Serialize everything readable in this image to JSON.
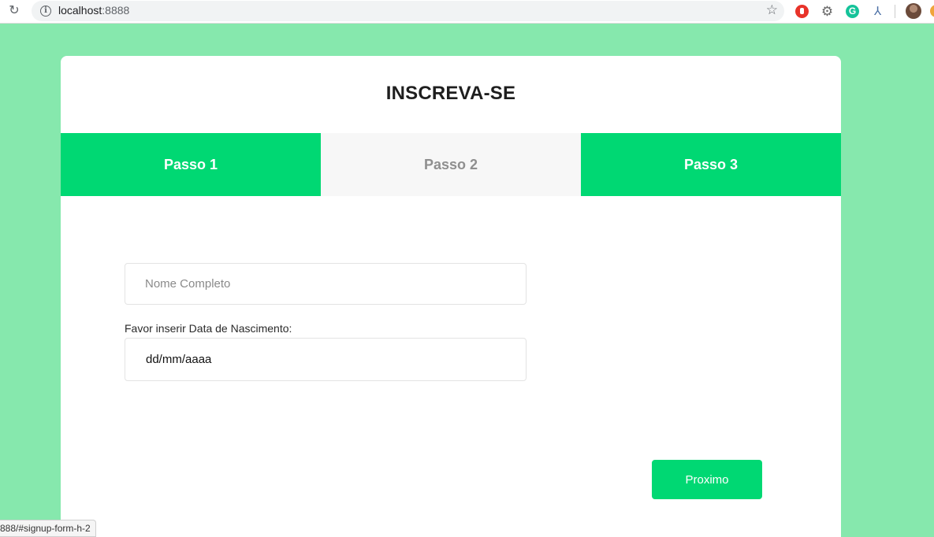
{
  "browser": {
    "url_host": "localhost",
    "url_port": ":8888",
    "status_url": "888/#signup-form-h-2"
  },
  "page": {
    "title": "INSCREVA-SE",
    "steps": [
      {
        "label": "Passo 1",
        "state": "active"
      },
      {
        "label": "Passo 2",
        "state": "inactive"
      },
      {
        "label": "Passo 3",
        "state": "active"
      }
    ],
    "name_field": {
      "placeholder": "Nome Completo",
      "value": ""
    },
    "date_label": "Favor inserir Data de Nascimento:",
    "date_field": {
      "value": "dd/mm/aaaa"
    },
    "next_button": "Proximo"
  },
  "colors": {
    "background": "#86e8ad",
    "accent": "#00d873",
    "inactive_step": "#f7f7f7"
  },
  "icons": {
    "reload": "reload-icon",
    "info": "info-icon",
    "bookmark": "star-icon",
    "extensions": [
      "adblock-icon",
      "gear-icon",
      "grammarly-icon",
      "extension-a-icon",
      "profile-avatar"
    ]
  }
}
